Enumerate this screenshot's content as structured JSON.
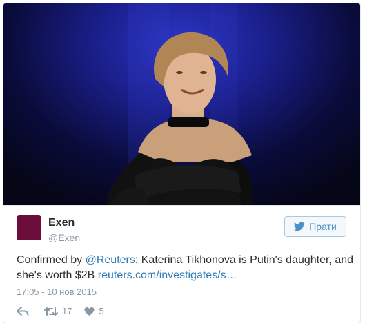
{
  "user": {
    "name": "Exen",
    "handle": "@Exen",
    "avatar_color": "#6b0e3b"
  },
  "follow_button": {
    "label": "Прати",
    "icon": "twitter-bird-icon"
  },
  "tweet": {
    "text_part1": "Confirmed by ",
    "mention": "@Reuters",
    "text_part2": ": Katerina Tikhonova is Putin's daughter, and she's worth $2B ",
    "link_text": "reuters.com/investigates/s…"
  },
  "timestamp": "17:05 - 10 нов 2015",
  "actions": {
    "reply_icon": "reply-icon",
    "retweet_icon": "retweet-icon",
    "retweet_count": "17",
    "like_icon": "heart-icon",
    "like_count": "5"
  },
  "colors": {
    "link": "#2b7bb9",
    "muted": "#8899a6",
    "text": "#292f33"
  }
}
